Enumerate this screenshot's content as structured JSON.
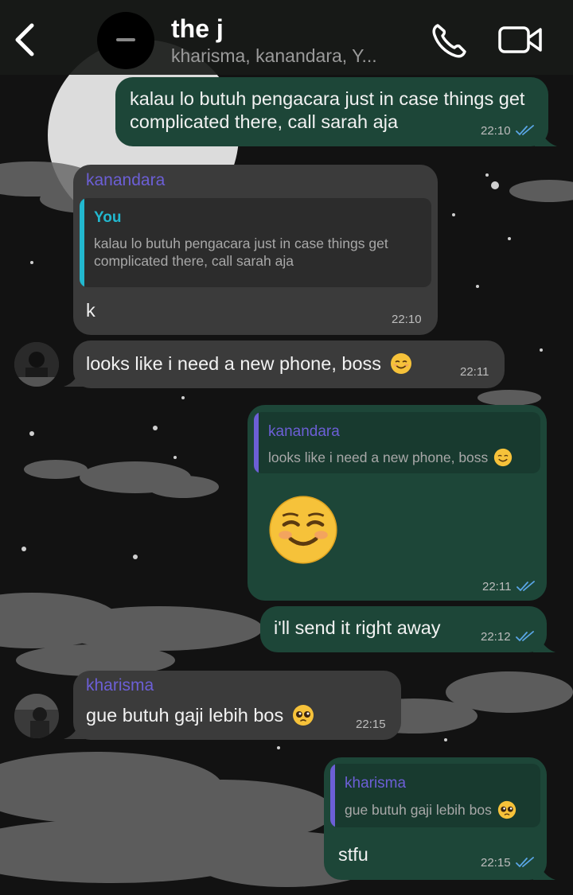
{
  "header": {
    "title": "the j",
    "subtitle": "kharisma, kanandara, Y..."
  },
  "messages": {
    "m1": {
      "text": "kalau lo butuh pengacara just in case things get complicated there, call sarah aja",
      "time": "22:10"
    },
    "m2": {
      "sender": "kanandara",
      "quote_name": "You",
      "quote_text": "kalau lo butuh pengacara just in case things get complicated there, call sarah aja",
      "text": "k",
      "time": "22:10"
    },
    "m3": {
      "text": "looks like i need a new phone, boss",
      "emoji": "relieved-smile",
      "time": "22:11"
    },
    "m4": {
      "quote_name": "kanandara",
      "quote_text": "looks like i need a new phone, boss",
      "quote_emoji": "relieved-smile",
      "emoji": "relieved-smile",
      "time": "22:11"
    },
    "m5": {
      "text": "i'll send it right away",
      "time": "22:12"
    },
    "m6": {
      "sender": "kharisma",
      "text": "gue butuh gaji lebih bos",
      "emoji": "pleading-face",
      "time": "22:15"
    },
    "m7": {
      "quote_name": "kharisma",
      "quote_text": "gue butuh gaji lebih bos",
      "quote_emoji": "pleading-face",
      "text": "stfu",
      "time": "22:15"
    }
  },
  "colors": {
    "outgoing_bubble": "#1d4638",
    "incoming_bubble": "#3b3b3b",
    "you_label": "#22b8cf",
    "sender_name": "#6c5fd6",
    "read_ticks": "#5aa6e6"
  }
}
